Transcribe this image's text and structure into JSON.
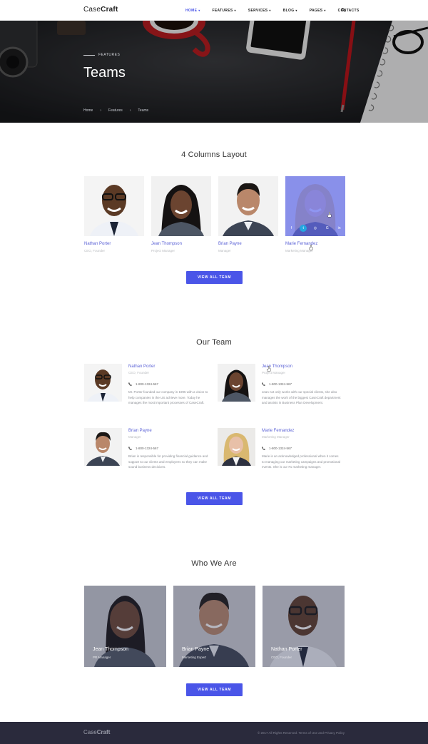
{
  "header": {
    "logo_light": "Case",
    "logo_bold": "Craft",
    "nav": [
      {
        "label": "HOME",
        "caret": "▾",
        "active": true
      },
      {
        "label": "FEATURES",
        "caret": "▾"
      },
      {
        "label": "SERVICES",
        "caret": "▾"
      },
      {
        "label": "BLOG",
        "caret": "▾"
      },
      {
        "label": "PAGES",
        "caret": "▾"
      },
      {
        "label": "CONTACTS",
        "caret": ""
      }
    ],
    "search_icon": "search-icon"
  },
  "hero": {
    "kicker": "FEATURES",
    "title": "Teams",
    "breadcrumb": [
      "Home",
      "Features",
      "Teams"
    ],
    "separator": "›"
  },
  "four_columns": {
    "title": "4 Columns Layout",
    "members": [
      {
        "name": "Nathan Porter",
        "role": "CEO, Founder"
      },
      {
        "name": "Jean Thompson",
        "role": "Project Manager"
      },
      {
        "name": "Brian Payne",
        "role": "Manager"
      },
      {
        "name": "Marie Fernandez",
        "role": "Marketing Manager"
      }
    ],
    "social": [
      "f",
      "t",
      "◎",
      "G",
      "in"
    ],
    "button": "VIEW ALL TEAM"
  },
  "our_team": {
    "title": "Our Team",
    "members": [
      {
        "name": "Nathan Porter",
        "role": "CEO, Founder",
        "phone": "1-800-1324-567",
        "bio": "Mr. Porter founded our company in 1995 with a vision to help companies in the US achieve more. Today he manages the most important processes of CaseCraft."
      },
      {
        "name": "Jean Thompson",
        "role": "Project Manager",
        "phone": "1-800-1324-567",
        "bio": "Jean not only works with our special clients, she also manages the work of the biggest CaseCraft department and assists in Business Plan Development."
      },
      {
        "name": "Brian Payne",
        "role": "Manager",
        "phone": "1-800-1324-567",
        "bio": "Brian is responsible for providing financial guidance and support to our clients and employees so they can make sound business decisions."
      },
      {
        "name": "Marie Fernandez",
        "role": "Marketing Manager",
        "phone": "1-800-1324-567",
        "bio": "Marie is an acknowledged professional when it comes to managing our marketing campaigns and promotional events. She is our #1 marketing manager."
      }
    ],
    "button": "VIEW ALL TEAM"
  },
  "who_we_are": {
    "title": "Who We Are",
    "members": [
      {
        "name": "Jean Thompson",
        "role": "PR Manager"
      },
      {
        "name": "Brian Payne",
        "role": "Marketing Expert"
      },
      {
        "name": "Nathan Porter",
        "role": "CEO, Founder"
      }
    ],
    "button": "VIEW ALL TEAM"
  },
  "footer": {
    "logo_light": "Case",
    "logo_bold": "Craft",
    "copyright": "© 2017 All Rights Reserved. Terms of Use and Privacy Policy"
  },
  "colors": {
    "accent": "#4a55e8",
    "footer": "#2a2a3c",
    "name_link": "#5b62d6"
  }
}
